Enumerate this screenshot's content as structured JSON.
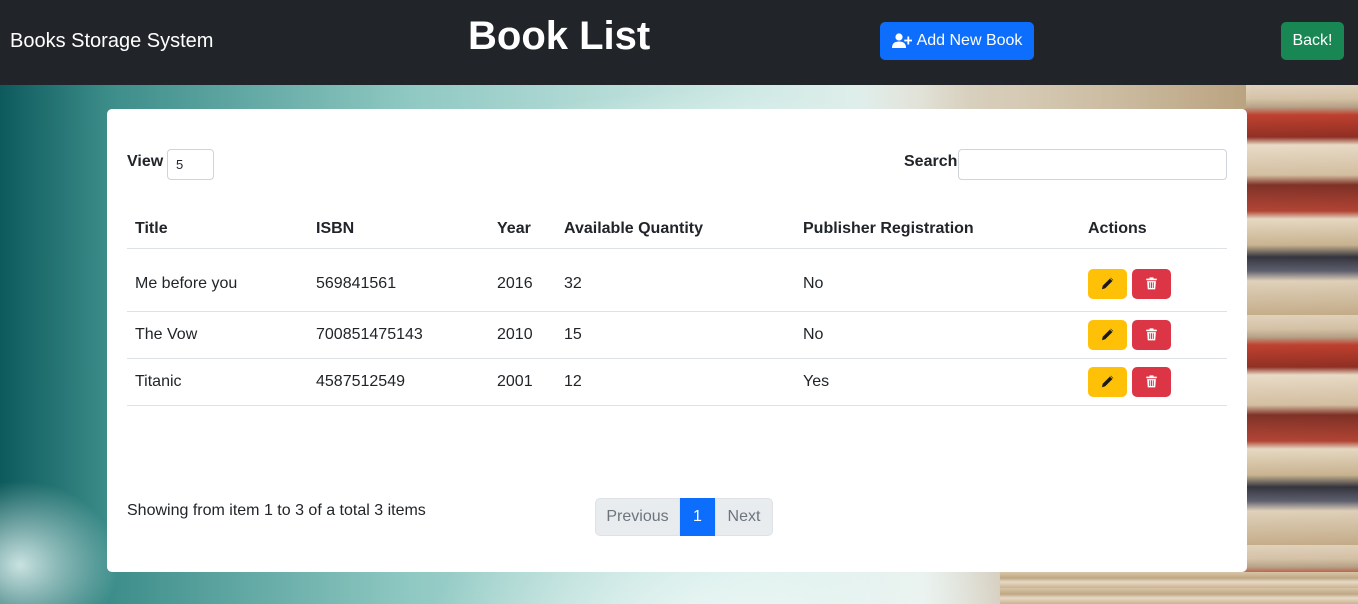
{
  "navbar": {
    "brand": "Books Storage System",
    "title": "Book List",
    "add_button": "Add New Book",
    "back_button": "Back!"
  },
  "controls": {
    "view_label": "View",
    "view_value": "5",
    "search_label": "Search",
    "search_value": ""
  },
  "table": {
    "headers": [
      "Title",
      "ISBN",
      "Year",
      "Available Quantity",
      "Publisher Registration",
      "Actions"
    ],
    "rows": [
      {
        "title": "Me before you",
        "isbn": "569841561",
        "year": "2016",
        "quantity": "32",
        "publisher": "No"
      },
      {
        "title": "The Vow",
        "isbn": "700851475143",
        "year": "2010",
        "quantity": "15",
        "publisher": "No"
      },
      {
        "title": "Titanic",
        "isbn": "4587512549",
        "year": "2001",
        "quantity": "12",
        "publisher": "Yes"
      }
    ]
  },
  "footer": {
    "summary": "Showing from item 1 to 3 of a total 3 items",
    "previous": "Previous",
    "current_page": "1",
    "next": "Next"
  },
  "colors": {
    "navbar": "#212529",
    "primary": "#0d6efd",
    "success": "#198754",
    "warning": "#ffc107",
    "danger": "#dc3545"
  },
  "icons": {
    "add_button": "user-plus-icon",
    "edit": "pencil-icon",
    "delete": "trash-icon"
  }
}
